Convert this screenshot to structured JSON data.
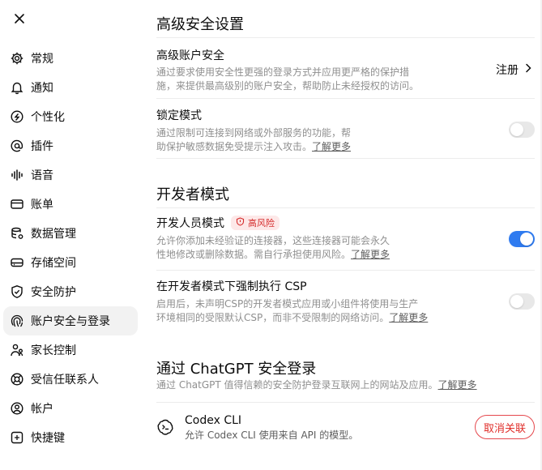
{
  "sidebar": {
    "close_label": "×",
    "items": [
      {
        "label": "常规",
        "icon": "gear-icon"
      },
      {
        "label": "通知",
        "icon": "bell-icon"
      },
      {
        "label": "个性化",
        "icon": "personalization-icon"
      },
      {
        "label": "插件",
        "icon": "at-icon"
      },
      {
        "label": "语音",
        "icon": "waveform-icon"
      },
      {
        "label": "账单",
        "icon": "credit-card-icon"
      },
      {
        "label": "数据管理",
        "icon": "database-icon"
      },
      {
        "label": "存储空间",
        "icon": "storage-icon"
      },
      {
        "label": "安全防护",
        "icon": "shield-icon"
      },
      {
        "label": "账户安全与登录",
        "icon": "fingerprint-icon",
        "active": true
      },
      {
        "label": "家长控制",
        "icon": "family-icon"
      },
      {
        "label": "受信任联系人",
        "icon": "lifebuoy-icon"
      },
      {
        "label": "帐户",
        "icon": "user-circle-icon"
      },
      {
        "label": "快捷键",
        "icon": "keyboard-shortcut-icon"
      }
    ]
  },
  "advanced_security": {
    "title": "高级安全设置",
    "account_security": {
      "title": "高级账户安全",
      "desc_line1": "通过要求使用安全性更强的登录方式并应用更严格的保护措",
      "desc_line2": "施，来提供最高级别的账户安全，帮助防止未经授权的访问。",
      "action_label": "注册"
    },
    "lockdown_mode": {
      "title": "锁定模式",
      "desc_line1": "通过限制可连接到网络或外部服务的功能，帮",
      "desc_line2": "助保护敏感数据免受提示注入攻击。",
      "link": "了解更多",
      "enabled": false
    }
  },
  "developer_mode": {
    "title": "开发者模式",
    "dev_mode": {
      "title": "开发人员模式",
      "badge": "高风险",
      "desc_line1": "允许你添加未经验证的连接器，这些连接器可能会永久",
      "desc_line2": "性地修改或删除数据。需自行承担使用风险。",
      "link": "了解更多",
      "enabled": true
    },
    "enforce_csp": {
      "title": "在开发者模式下强制执行 CSP",
      "desc_line1": "启用后，未声明CSP的开发者模式应用或小组件将使用与生产",
      "desc_line2": "环境相同的受限默认CSP，而非不受限制的网络访问。",
      "link": "了解更多",
      "enabled": false
    }
  },
  "chatgpt_login": {
    "title": "通过 ChatGPT 安全登录",
    "desc": "通过 ChatGPT 值得信赖的安全防护登录互联网上的网站及应用。",
    "link": "了解更多",
    "apps": [
      {
        "name": "Codex CLI",
        "desc": "允许 Codex CLI 使用来自 API 的模型。",
        "action": "取消关联"
      }
    ]
  },
  "colors": {
    "accent": "#2f7bf0",
    "danger": "#e02e2a",
    "muted_text": "#8f8f8f",
    "active_nav_bg": "#f2f2f2"
  }
}
